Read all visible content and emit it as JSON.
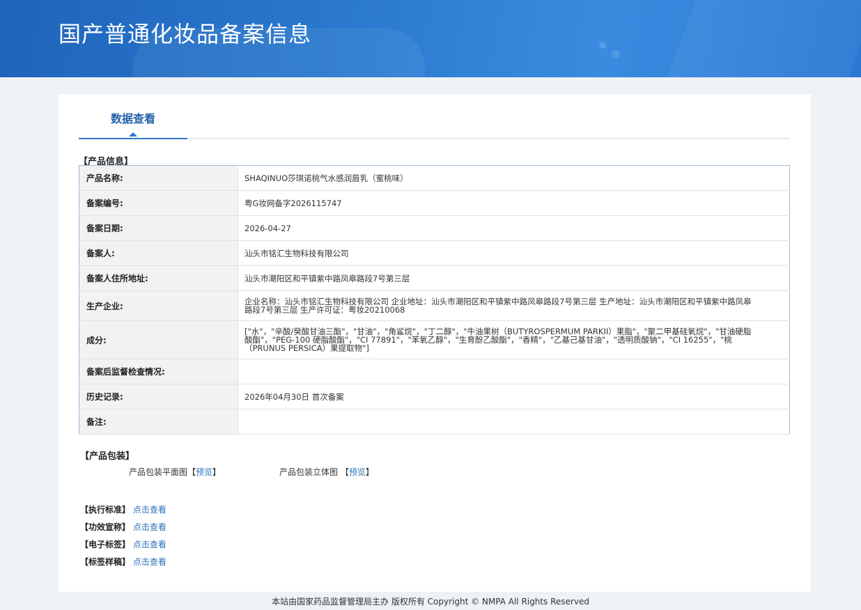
{
  "header": {
    "title": "国产普通化妆品备案信息"
  },
  "tabs": [
    {
      "label": "数据查看"
    }
  ],
  "product_info": {
    "heading": "【产品信息】",
    "rows": [
      {
        "label": "产品名称:",
        "value": "SHAQINUO莎琪诺桃气水感润唇乳（蜜桃味）"
      },
      {
        "label": "备案编号:",
        "value": "粤G妆网备字2026115747"
      },
      {
        "label": "备案日期:",
        "value": "2026-04-27"
      },
      {
        "label": "备案人:",
        "value": "汕头市铭汇生物科技有限公司"
      },
      {
        "label": "备案人住所地址:",
        "value": "汕头市潮阳区和平镇紫中路凤皋路段7号第三层"
      },
      {
        "label": "生产企业:",
        "value": "企业名称：汕头市铭汇生物科技有限公司 企业地址：汕头市潮阳区和平镇紫中路凤皋路段7号第三层 生产地址：汕头市潮阳区和平镇紫中路凤皋路段7号第三层 生产许可证：粤妆20210068"
      },
      {
        "label": "成分:",
        "value": "[\"水\"，\"辛酸/癸酸甘油三酯\"，\"甘油\"，\"角鲨烷\"，\"丁二醇\"，\"牛油果树（BUTYROSPERMUM PARKII）果脂\"，\"聚二甲基硅氧烷\"，\"甘油硬脂酸酯\"，\"PEG-100 硬脂酸酯\"，\"CI 77891\"，\"苯氧乙醇\"，\"生育酚乙酸酯\"，\"香精\"，\"乙基己基甘油\"，\"透明质酸钠\"，\"CI 16255\"，\"桃（PRUNUS PERSICA）果提取物\"]"
      },
      {
        "label": "备案后监督检查情况:",
        "value": ""
      },
      {
        "label": "历史记录:",
        "value": "2026年04月30日 首次备案"
      },
      {
        "label": "备注:",
        "value": ""
      }
    ]
  },
  "packaging": {
    "heading": "【产品包装】",
    "flat_label": "产品包装平面图",
    "flat_link": "预览",
    "solid_label": "产品包装立体图",
    "solid_link": "预览",
    "bracket_open": "【",
    "bracket_close": "】"
  },
  "links": [
    {
      "label": "【执行标准】",
      "link": "点击查看"
    },
    {
      "label": "【功效宣称】",
      "link": "点击查看"
    },
    {
      "label": "【电子标签】",
      "link": "点击查看"
    },
    {
      "label": "【标签样稿】",
      "link": "点击查看"
    }
  ],
  "footer": {
    "text": "本站由国家药品监督管理局主办 版权所有 Copyright © NMPA All Rights Reserved"
  }
}
